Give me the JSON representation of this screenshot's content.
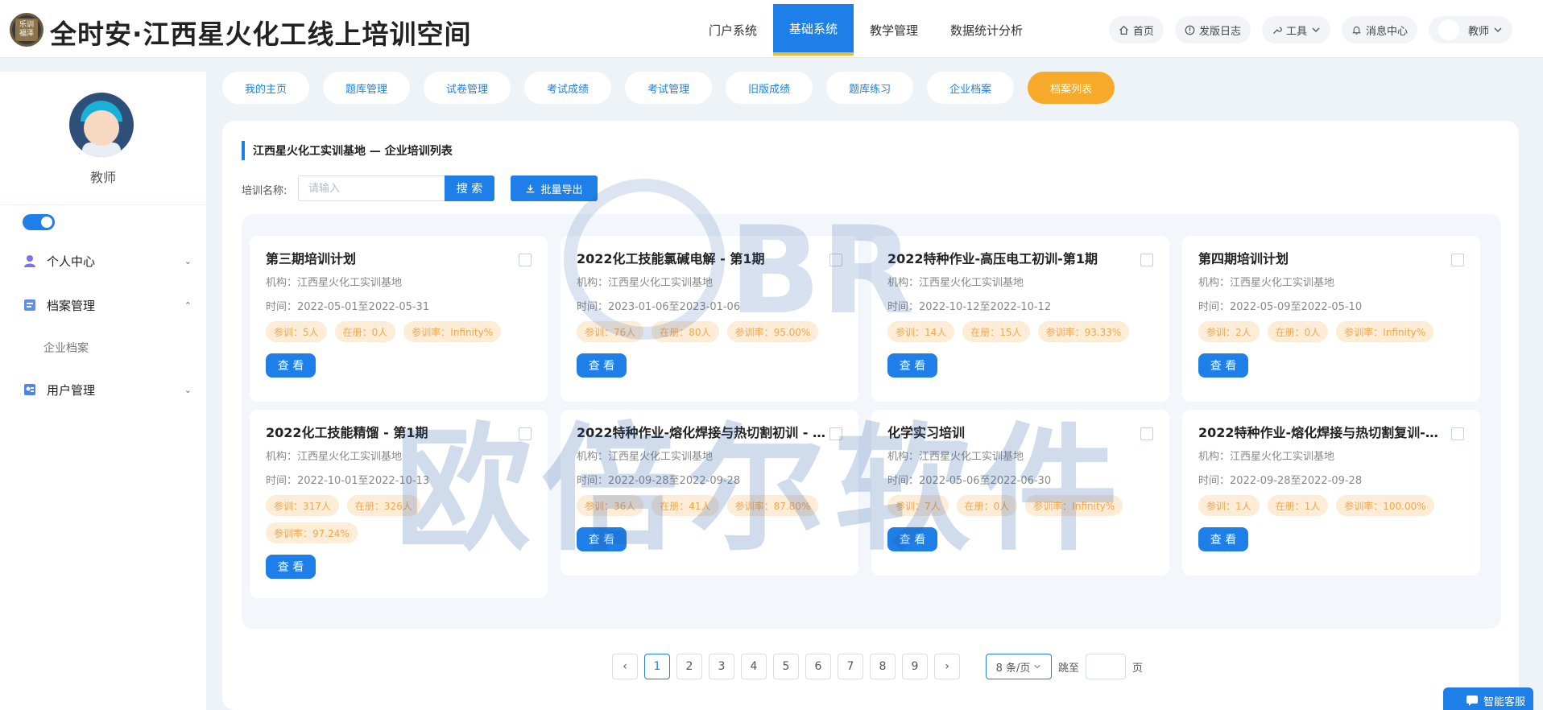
{
  "header": {
    "logo_text": "乐训\n福泽",
    "site_title": "全时安·江西星火化工线上培训空间",
    "nav": [
      {
        "label": "门户系统"
      },
      {
        "label": "基础系统"
      },
      {
        "label": "教学管理"
      },
      {
        "label": "数据统计分析"
      }
    ],
    "buttons": {
      "home": "首页",
      "changelog": "发版日志",
      "tools": "工具",
      "messages": "消息中心",
      "user": "教师"
    }
  },
  "sidebar": {
    "role": "教师",
    "menu": [
      {
        "label": "个人中心"
      },
      {
        "label": "档案管理"
      },
      {
        "label": "用户管理"
      }
    ],
    "submenu": [
      {
        "label": "企业档案"
      }
    ]
  },
  "tabs": [
    {
      "label": "我的主页"
    },
    {
      "label": "题库管理"
    },
    {
      "label": "试卷管理"
    },
    {
      "label": "考试成绩"
    },
    {
      "label": "考试管理"
    },
    {
      "label": "旧版成绩"
    },
    {
      "label": "题库练习"
    },
    {
      "label": "企业档案"
    },
    {
      "label": "档案列表"
    }
  ],
  "panel": {
    "title": "江西星火化工实训基地 — 企业培训列表",
    "search_label": "培训名称:",
    "search_placeholder": "请输入",
    "search_button": "搜 索",
    "export_button": "批量导出"
  },
  "view_label": "查 看",
  "cards": [
    {
      "title": "第三期培训计划",
      "org": "机构：江西星火化工实训基地",
      "time": "时间：2022-05-01至2022-05-31",
      "pills": [
        "参训：5人",
        "在册：0人",
        "参训率：Infinity%"
      ]
    },
    {
      "title": "2022化工技能氯碱电解 - 第1期",
      "org": "机构：江西星火化工实训基地",
      "time": "时间：2023-01-06至2023-01-06",
      "pills": [
        "参训：76人",
        "在册：80人",
        "参训率：95.00%"
      ]
    },
    {
      "title": "2022特种作业-高压电工初训-第1期",
      "org": "机构：江西星火化工实训基地",
      "time": "时间：2022-10-12至2022-10-12",
      "pills": [
        "参训：14人",
        "在册：15人",
        "参训率：93.33%"
      ]
    },
    {
      "title": "第四期培训计划",
      "org": "机构：江西星火化工实训基地",
      "time": "时间：2022-05-09至2022-05-10",
      "pills": [
        "参训：2人",
        "在册：0人",
        "参训率：Infinity%"
      ]
    },
    {
      "title": "2022化工技能精馏 - 第1期",
      "org": "机构：江西星火化工实训基地",
      "time": "时间：2022-10-01至2022-10-13",
      "pills": [
        "参训：317人",
        "在册：326人",
        "参训率：97.24%"
      ]
    },
    {
      "title": "2022特种作业-熔化焊接与热切割初训 - ...",
      "org": "机构：江西星火化工实训基地",
      "time": "时间：2022-09-28至2022-09-28",
      "pills": [
        "参训：36人",
        "在册：41人",
        "参训率：87.80%"
      ]
    },
    {
      "title": "化学实习培训",
      "org": "机构：江西星火化工实训基地",
      "time": "时间：2022-05-06至2022-06-30",
      "pills": [
        "参训：7人",
        "在册：0人",
        "参训率：Infinity%"
      ]
    },
    {
      "title": "2022特种作业-熔化焊接与热切割复训-第...",
      "org": "机构：江西星火化工实训基地",
      "time": "时间：2022-09-28至2022-09-28",
      "pills": [
        "参训：1人",
        "在册：1人",
        "参训率：100.00%"
      ]
    }
  ],
  "pagination": {
    "prev": "‹",
    "next": "›",
    "pages": [
      "1",
      "2",
      "3",
      "4",
      "5",
      "6",
      "7",
      "8",
      "9"
    ],
    "current": "1",
    "page_size": "8 条/页",
    "jump_label": "跳至",
    "page_suffix": "页"
  },
  "watermark": {
    "main": "欧倍尔软件",
    "logo": "BR"
  },
  "chat_label": "智能客服",
  "colors": {
    "primary": "#1e7fe8",
    "accent": "#f7a92a",
    "pill_bg": "#fdecd6",
    "pill_text": "#f7a64a"
  }
}
